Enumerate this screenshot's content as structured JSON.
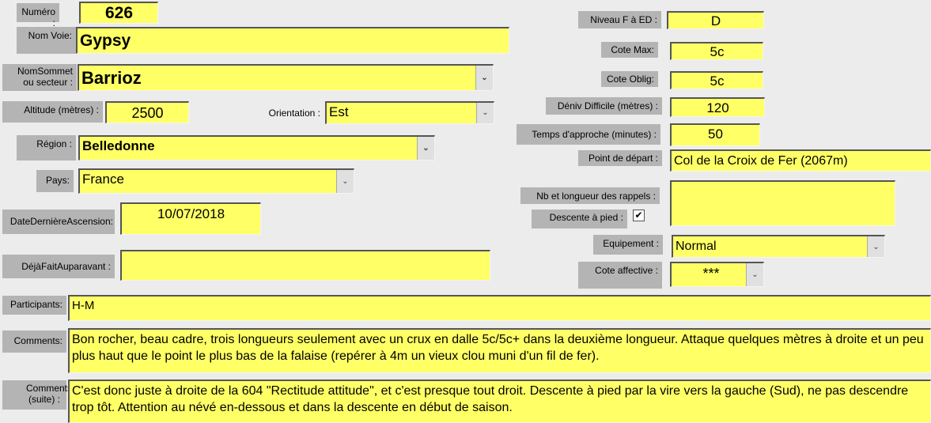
{
  "form": {
    "numero": {
      "label": "Numéro :",
      "value": "626"
    },
    "nom_voie": {
      "label": "Nom Voie:",
      "value": "Gypsy"
    },
    "nom_sommet": {
      "label": "NomSommet ou secteur :",
      "value": "Barrioz"
    },
    "altitude": {
      "label": "Altitude (mètres) :",
      "value": "2500"
    },
    "orientation": {
      "label": "Orientation :",
      "value": "Est"
    },
    "region": {
      "label": "Région :",
      "value": "Belledonne"
    },
    "pays": {
      "label": "Pays:",
      "value": "France"
    },
    "date_derniere": {
      "label": "DateDernièreAscension:",
      "value": "10/07/2018"
    },
    "deja_fait": {
      "label": "DéjàFaitAuparavant :",
      "value": ""
    },
    "niveau": {
      "label": "Niveau F à ED :",
      "value": "D"
    },
    "cote_max": {
      "label": "Cote Max:",
      "value": "5c"
    },
    "cote_oblig": {
      "label": "Cote Oblig:",
      "value": "5c"
    },
    "deniv": {
      "label": "Déniv Difficile (mètres) :",
      "value": "120"
    },
    "temps_approche": {
      "label": "Temps d'approche (minutes) :",
      "value": "50"
    },
    "point_depart": {
      "label": "Point de départ :",
      "value": "Col de la Croix de Fer (2067m)"
    },
    "rappels": {
      "label": "Nb et longueur des rappels :",
      "value": ""
    },
    "descente_pied": {
      "label": "Descente à pied :",
      "checked": true,
      "mark": "✔"
    },
    "equipement": {
      "label": "Equipement :",
      "value": "Normal"
    },
    "cote_affective": {
      "label": "Cote affective :",
      "value": "***"
    },
    "participants": {
      "label": "Participants:",
      "value": "H-M"
    },
    "comments": {
      "label": "Comments:",
      "value": "Bon rocher, beau cadre, trois longueurs seulement avec un crux en dalle 5c/5c+ dans la deuxième longueur. Attaque quelques mètres à droite et un peu plus haut que le point le plus bas de la falaise (repérer à 4m un vieux clou muni d'un fil de fer)."
    },
    "comments_suite": {
      "label": "Comments (suite) :",
      "value": "C'est donc juste à droite de la 604 \"Rectitude attitude\", et c'est presque tout droit. Descente à pied par la vire vers la gauche (Sud), ne pas descendre trop tôt. Attention au névé en-dessous et dans la descente en début de saison."
    }
  },
  "icons": {
    "dropdown": "chevron-down-icon",
    "dropdown_glyph": "⌄"
  },
  "colors": {
    "field": "#ffff66",
    "label": "#b4b4b4",
    "background": "#ececec"
  }
}
